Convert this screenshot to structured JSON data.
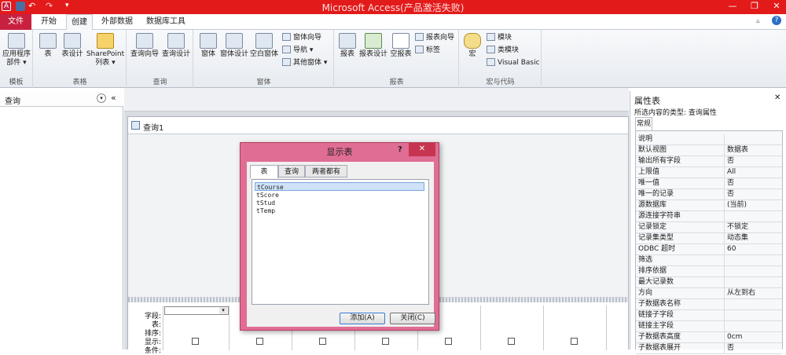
{
  "window": {
    "title": "Microsoft Access(产品激活失败)",
    "accent": "#e31a1a"
  },
  "tabs": [
    "文件",
    "开始",
    "创建",
    "外部数据",
    "数据库工具"
  ],
  "ribbon": {
    "groups": [
      {
        "label": "模板",
        "buttons": [
          {
            "label": "应用程序\n部件 ▾",
            "icon": "app-parts-icon"
          }
        ]
      },
      {
        "label": "表格",
        "buttons": [
          {
            "label": "表",
            "icon": "table-icon"
          },
          {
            "label": "表设计",
            "icon": "table-design-icon"
          },
          {
            "label": "SharePoint\n列表 ▾",
            "icon": "sharepoint-list-icon"
          }
        ]
      },
      {
        "label": "查询",
        "buttons": [
          {
            "label": "查询向导",
            "icon": "query-wizard-icon"
          },
          {
            "label": "查询设计",
            "icon": "query-design-icon"
          }
        ]
      },
      {
        "label": "窗体",
        "buttons": [
          {
            "label": "窗体",
            "icon": "form-icon"
          },
          {
            "label": "窗体设计",
            "icon": "form-design-icon"
          },
          {
            "label": "空白窗体",
            "icon": "blank-form-icon"
          }
        ],
        "small": [
          "窗体向导",
          "导航 ▾",
          "其他窗体 ▾"
        ]
      },
      {
        "label": "报表",
        "buttons": [
          {
            "label": "报表",
            "icon": "report-icon"
          },
          {
            "label": "报表设计",
            "icon": "report-design-icon"
          },
          {
            "label": "空报表",
            "icon": "blank-report-icon"
          }
        ],
        "small": [
          "报表向导",
          "标签"
        ]
      },
      {
        "label": "宏与代码",
        "buttons": [
          {
            "label": "宏",
            "icon": "macro-icon"
          }
        ],
        "small": [
          "模块",
          "类模块",
          "Visual Basic"
        ]
      }
    ]
  },
  "nav": {
    "title": "查询"
  },
  "query": {
    "tab_title": "查询1",
    "grid_labels": [
      "字段:",
      "表:",
      "排序:",
      "显示:",
      "条件:"
    ]
  },
  "dialog": {
    "title": "显示表",
    "help": "?",
    "close": "✕",
    "tabs": [
      "表",
      "查询",
      "两者都有"
    ],
    "tables": [
      "tCourse",
      "tScore",
      "tStud",
      "tTemp"
    ],
    "selected": "tCourse",
    "add": "添加(A)",
    "close_btn": "关闭(C)"
  },
  "props": {
    "title": "属性表",
    "selection_type": "所选内容的类型: 查询属性",
    "tab": "常规",
    "rows": [
      {
        "name": "说明",
        "value": ""
      },
      {
        "name": "默认视图",
        "value": "数据表"
      },
      {
        "name": "输出所有字段",
        "value": "否"
      },
      {
        "name": "上限值",
        "value": "All"
      },
      {
        "name": "唯一值",
        "value": "否"
      },
      {
        "name": "唯一的记录",
        "value": "否"
      },
      {
        "name": "源数据库",
        "value": "(当前)"
      },
      {
        "name": "源连接字符串",
        "value": ""
      },
      {
        "name": "记录锁定",
        "value": "不锁定"
      },
      {
        "name": "记录集类型",
        "value": "动态集"
      },
      {
        "name": "ODBC 超时",
        "value": "60"
      },
      {
        "name": "筛选",
        "value": ""
      },
      {
        "name": "排序依据",
        "value": ""
      },
      {
        "name": "最大记录数",
        "value": ""
      },
      {
        "name": "方向",
        "value": "从左到右"
      },
      {
        "name": "子数据表名称",
        "value": ""
      },
      {
        "name": "链接子字段",
        "value": ""
      },
      {
        "name": "链接主字段",
        "value": ""
      },
      {
        "name": "子数据表高度",
        "value": "0cm"
      },
      {
        "name": "子数据表展开",
        "value": "否"
      }
    ]
  }
}
